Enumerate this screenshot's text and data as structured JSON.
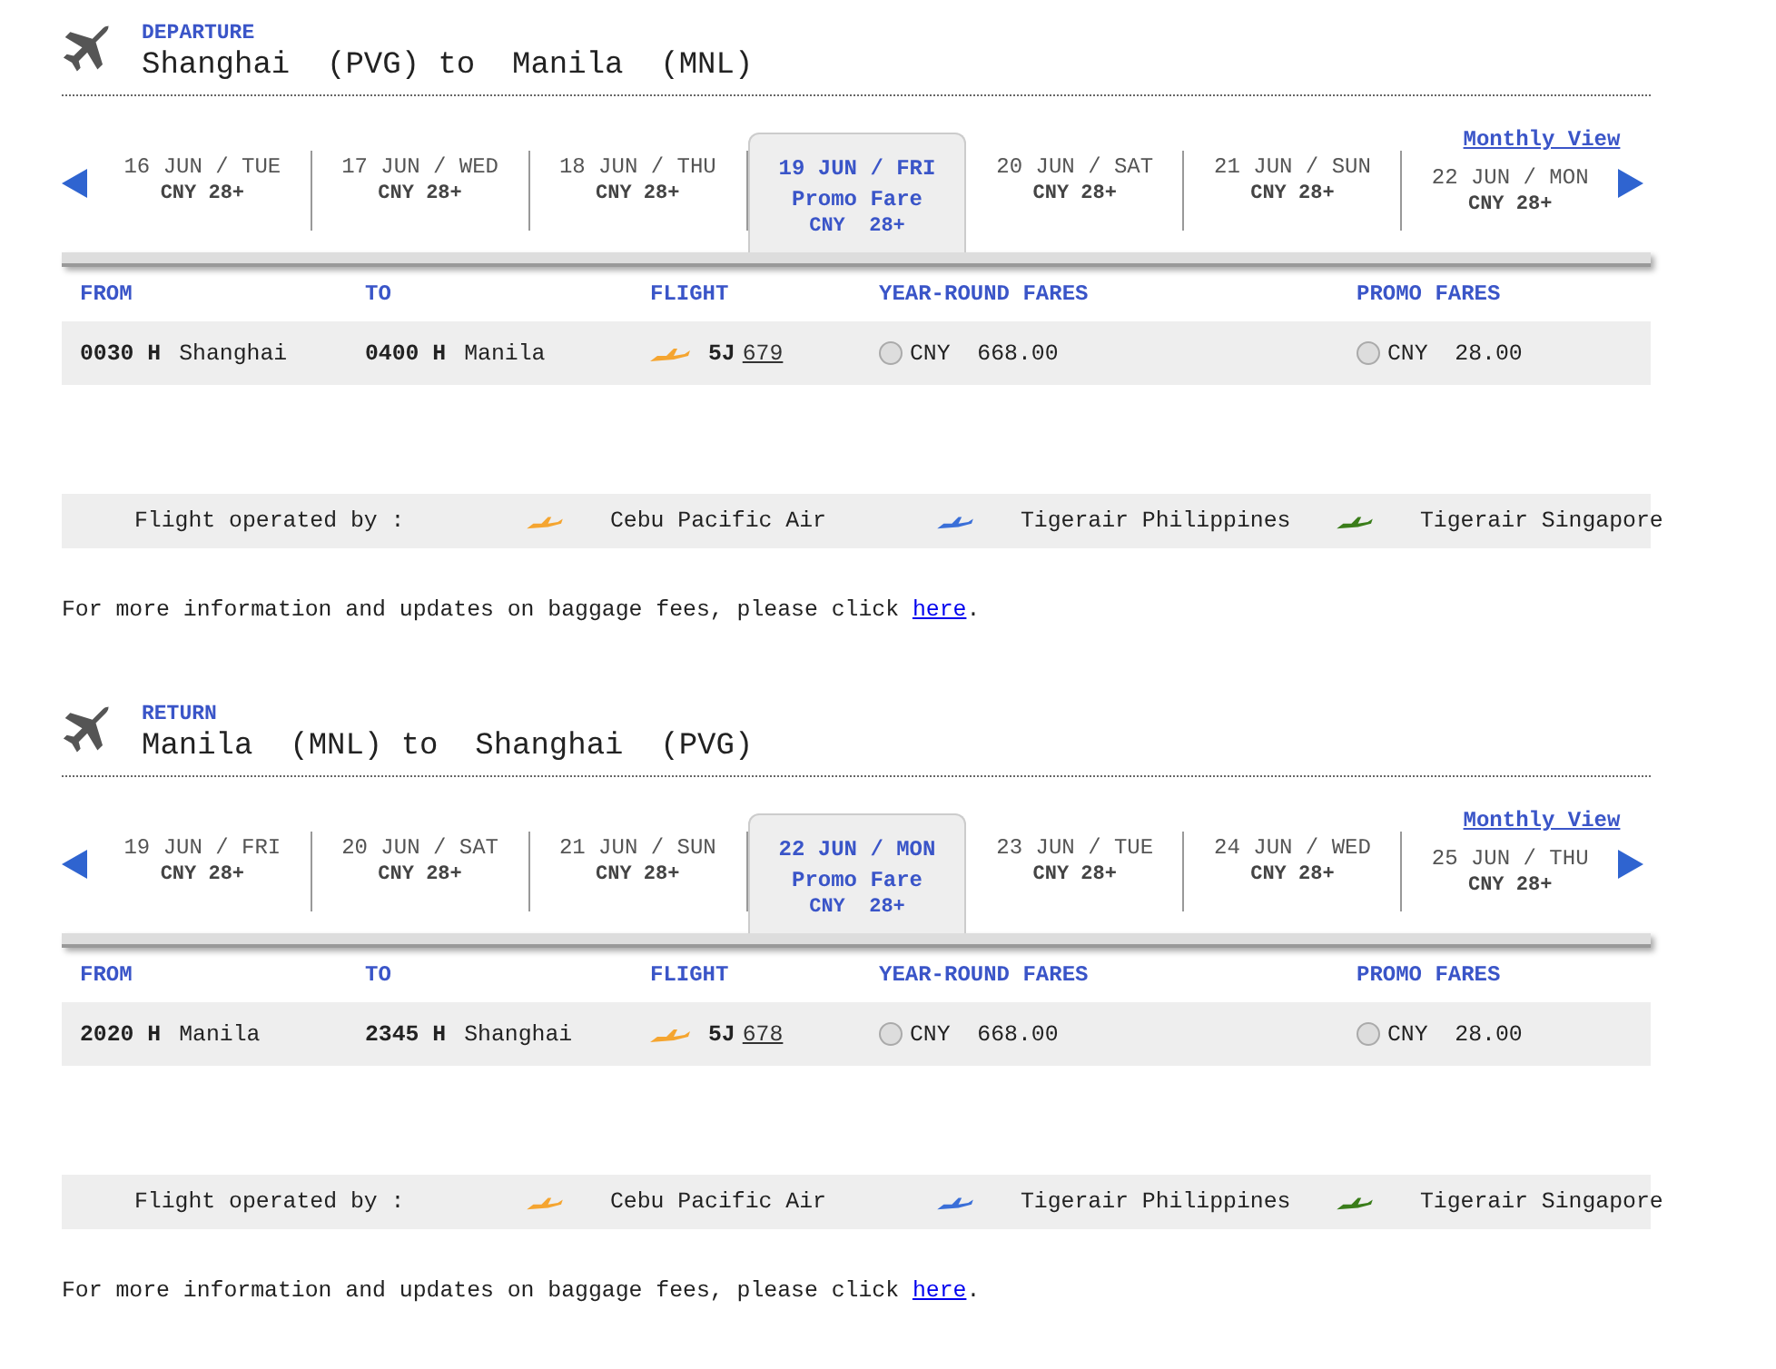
{
  "sections": [
    {
      "label": "DEPARTURE",
      "title": "Shanghai  (PVG) to  Manila  (MNL)",
      "monthly_view": "Monthly View",
      "dates": [
        {
          "date": "16 JUN / TUE",
          "price": "CNY 28+",
          "selected": false
        },
        {
          "date": "17 JUN / WED",
          "price": "CNY 28+",
          "selected": false
        },
        {
          "date": "18 JUN / THU",
          "price": "CNY 28+",
          "selected": false
        },
        {
          "date": "19 JUN / FRI",
          "promo": "Promo Fare",
          "price": "CNY  28+",
          "selected": true
        },
        {
          "date": "20 JUN / SAT",
          "price": "CNY 28+",
          "selected": false
        },
        {
          "date": "21 JUN / SUN",
          "price": "CNY 28+",
          "selected": false
        },
        {
          "date": "22 JUN / MON",
          "price": "CNY 28+",
          "selected": false
        }
      ],
      "columns": [
        "FROM",
        "TO",
        "FLIGHT",
        "YEAR-ROUND FARES",
        "PROMO FARES"
      ],
      "flights": [
        {
          "dep_time": "0030 H",
          "from": "Shanghai",
          "arr_time": "0400 H",
          "to": "Manila",
          "carrier": "5J",
          "number": "679",
          "color": "#f5a530",
          "fares": [
            {
              "amount": "CNY  668.00",
              "selected": false
            },
            {
              "amount": "CNY  28.00",
              "selected": false
            }
          ]
        }
      ],
      "operated_label": "Flight operated by :",
      "operators": [
        {
          "name": "Cebu Pacific Air",
          "color": "#f5a530"
        },
        {
          "name": "Tigerair Philippines",
          "color": "#3a6fd8"
        },
        {
          "name": "Tigerair Singapore",
          "color": "#3a7d1a"
        }
      ],
      "info": {
        "text": "For more information and updates on baggage fees, please click ",
        "link": "here",
        "end": "."
      }
    },
    {
      "label": "RETURN",
      "title": "Manila  (MNL) to  Shanghai  (PVG)",
      "monthly_view": "Monthly View",
      "dates": [
        {
          "date": "19 JUN / FRI",
          "price": "CNY 28+",
          "selected": false
        },
        {
          "date": "20 JUN / SAT",
          "price": "CNY 28+",
          "selected": false
        },
        {
          "date": "21 JUN / SUN",
          "price": "CNY 28+",
          "selected": false
        },
        {
          "date": "22 JUN / MON",
          "promo": "Promo Fare",
          "price": "CNY  28+",
          "selected": true
        },
        {
          "date": "23 JUN / TUE",
          "price": "CNY 28+",
          "selected": false
        },
        {
          "date": "24 JUN / WED",
          "price": "CNY 28+",
          "selected": false
        },
        {
          "date": "25 JUN / THU",
          "price": "CNY 28+",
          "selected": false
        }
      ],
      "columns": [
        "FROM",
        "TO",
        "FLIGHT",
        "YEAR-ROUND FARES",
        "PROMO FARES"
      ],
      "flights": [
        {
          "dep_time": "2020 H",
          "from": "Manila",
          "arr_time": "2345 H",
          "to": "Shanghai",
          "carrier": "5J",
          "number": "678",
          "color": "#f5a530",
          "fares": [
            {
              "amount": "CNY  668.00",
              "selected": false
            },
            {
              "amount": "CNY  28.00",
              "selected": false
            }
          ]
        }
      ],
      "operated_label": "Flight operated by :",
      "operators": [
        {
          "name": "Cebu Pacific Air",
          "color": "#f5a530"
        },
        {
          "name": "Tigerair Philippines",
          "color": "#3a6fd8"
        },
        {
          "name": "Tigerair Singapore",
          "color": "#3a7d1a"
        }
      ],
      "info": {
        "text": "For more information and updates on baggage fees, please click ",
        "link": "here",
        "end": "."
      }
    }
  ]
}
